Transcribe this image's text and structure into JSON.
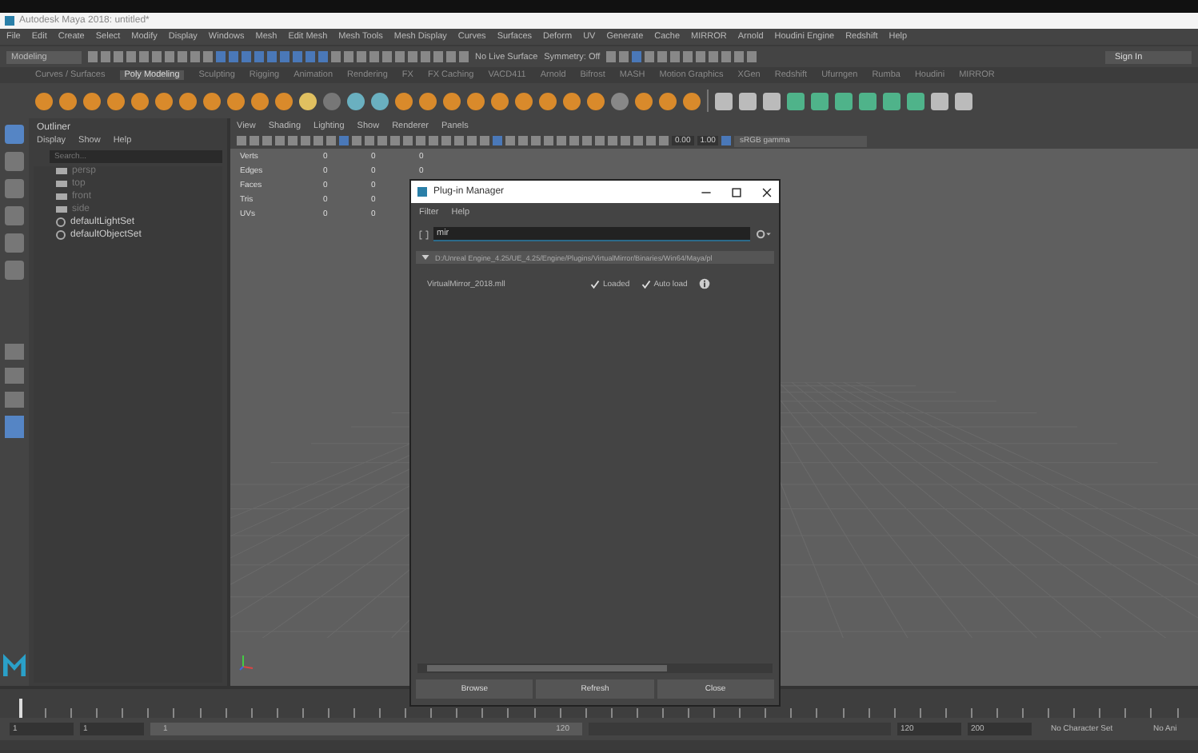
{
  "window": {
    "title": "Autodesk Maya 2018: untitled*"
  },
  "menu_bar": [
    "File",
    "Edit",
    "Create",
    "Select",
    "Modify",
    "Display",
    "Windows",
    "Mesh",
    "Edit Mesh",
    "Mesh Tools",
    "Mesh Display",
    "Curves",
    "Surfaces",
    "Deform",
    "UV",
    "Generate",
    "Cache",
    "MIRROR",
    "Arnold",
    "Houdini Engine",
    "Redshift",
    "Help"
  ],
  "status_line": {
    "workspace": "Modeling",
    "live_surface": "No Live Surface",
    "symmetry": "Symmetry: Off",
    "sign_in": "Sign In"
  },
  "shelf_tabs": [
    {
      "label": "Curves / Surfaces",
      "selected": false
    },
    {
      "label": "Poly Modeling",
      "selected": true
    },
    {
      "label": "Sculpting",
      "selected": false
    },
    {
      "label": "Rigging",
      "selected": false
    },
    {
      "label": "Animation",
      "selected": false
    },
    {
      "label": "Rendering",
      "selected": false
    },
    {
      "label": "FX",
      "selected": false
    },
    {
      "label": "FX Caching",
      "selected": false
    },
    {
      "label": "VACD411",
      "selected": false
    },
    {
      "label": "Arnold",
      "selected": false
    },
    {
      "label": "Bifrost",
      "selected": false
    },
    {
      "label": "MASH",
      "selected": false
    },
    {
      "label": "Motion Graphics",
      "selected": false
    },
    {
      "label": "XGen",
      "selected": false
    },
    {
      "label": "Redshift",
      "selected": false
    },
    {
      "label": "Ufurngen",
      "selected": false
    },
    {
      "label": "Rumba",
      "selected": false
    },
    {
      "label": "Houdini",
      "selected": false
    },
    {
      "label": "MIRROR",
      "selected": false
    }
  ],
  "outliner": {
    "title": "Outliner",
    "menus": [
      "Display",
      "Show",
      "Help"
    ],
    "search": {
      "placeholder": "Search..."
    },
    "items": [
      {
        "label": "persp",
        "kind": "camera"
      },
      {
        "label": "top",
        "kind": "camera"
      },
      {
        "label": "front",
        "kind": "camera"
      },
      {
        "label": "side",
        "kind": "camera"
      },
      {
        "label": "defaultLightSet",
        "kind": "set"
      },
      {
        "label": "defaultObjectSet",
        "kind": "set"
      }
    ]
  },
  "viewport": {
    "menus": [
      "View",
      "Shading",
      "Lighting",
      "Show",
      "Renderer",
      "Panels"
    ],
    "fields": [
      "0.00",
      "1.00"
    ],
    "color_space": "sRGB gamma",
    "stats": [
      {
        "label": "Verts",
        "values": [
          "0",
          "0",
          "0"
        ]
      },
      {
        "label": "Edges",
        "values": [
          "0",
          "0",
          "0"
        ]
      },
      {
        "label": "Faces",
        "values": [
          "0",
          "0"
        ]
      },
      {
        "label": "Tris",
        "values": [
          "0",
          "0"
        ]
      },
      {
        "label": "UVs",
        "values": [
          "0",
          "0"
        ]
      }
    ]
  },
  "plugin_manager": {
    "title": "Plug-in Manager",
    "menus": [
      "Filter",
      "Help"
    ],
    "search": {
      "value": "mir"
    },
    "path": "D:/Unreal Engine_4.25/UE_4.25/Engine/Plugins/VirtualMirror/Binaries/Win64/Maya/pl",
    "plugins": [
      {
        "name": "VirtualMirror_2018.mll",
        "loaded": true,
        "auto_load": true,
        "loaded_label": "Loaded",
        "auto_load_label": "Auto load"
      }
    ],
    "buttons": [
      "Browse",
      "Refresh",
      "Close"
    ]
  },
  "time_slider": {
    "level": 0
  },
  "range_slider": {
    "level": 1,
    "start": "1",
    "current": "1",
    "range_start": "1",
    "range_end": "120",
    "end": "120",
    "max": "200",
    "character_set": "No Character Set",
    "anim_layer": "No Ani"
  }
}
